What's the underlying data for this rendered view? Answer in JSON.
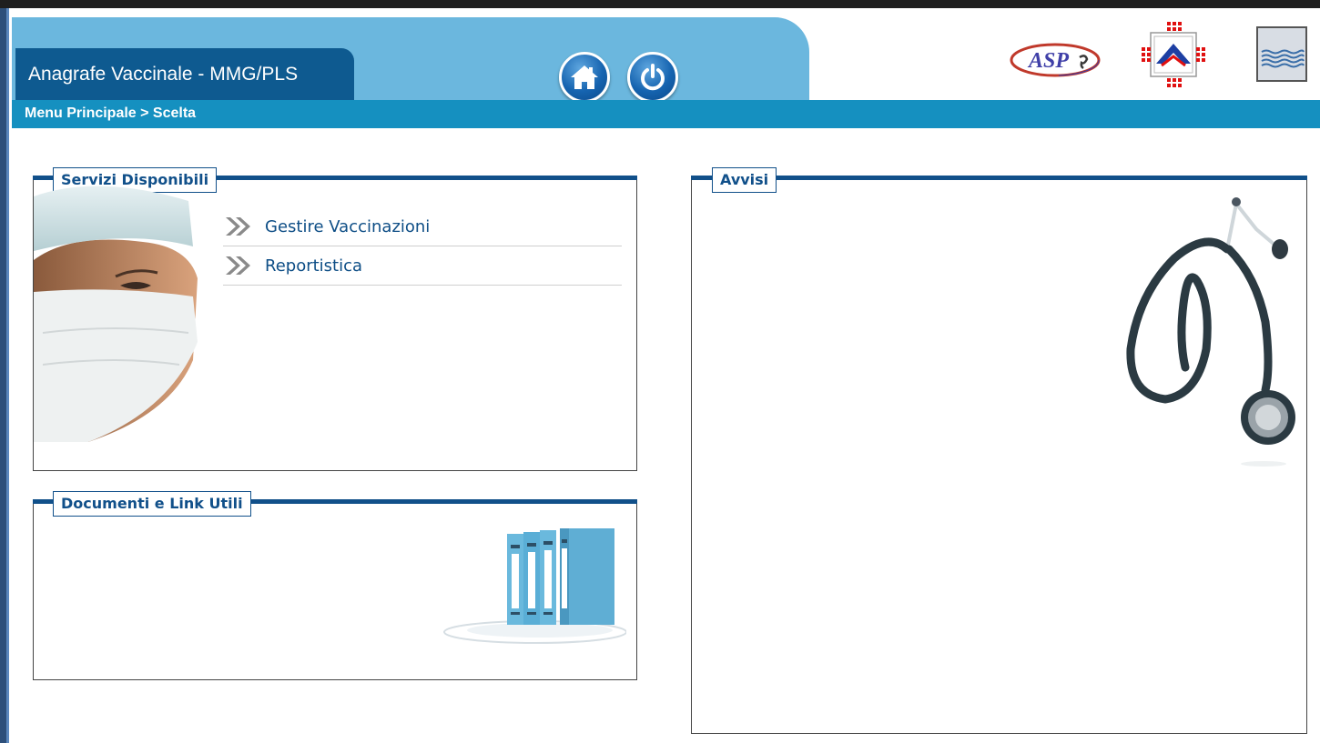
{
  "header": {
    "app_title": "Anagrafe Vaccinale - MMG/PLS",
    "home_icon": "home-icon",
    "logout_icon": "power-icon",
    "logos": [
      "asp-logo",
      "region-logo",
      "coat-of-arms-logo"
    ],
    "logo_asp_text": "ASP"
  },
  "breadcrumb": "Menu Principale > Scelta",
  "servizi": {
    "title": "Servizi Disponibili",
    "items": [
      {
        "label": "Gestire Vaccinazioni",
        "icon": "double-chevron-icon"
      },
      {
        "label": "Reportistica",
        "icon": "double-chevron-icon"
      }
    ]
  },
  "documenti": {
    "title": "Documenti e Link Utili"
  },
  "avvisi": {
    "title": "Avvisi"
  },
  "colors": {
    "header_light": "#6bb7de",
    "title_dark": "#0e5a90",
    "breadcrumb_bar": "#1590c0",
    "panel_accent": "#11508a"
  }
}
